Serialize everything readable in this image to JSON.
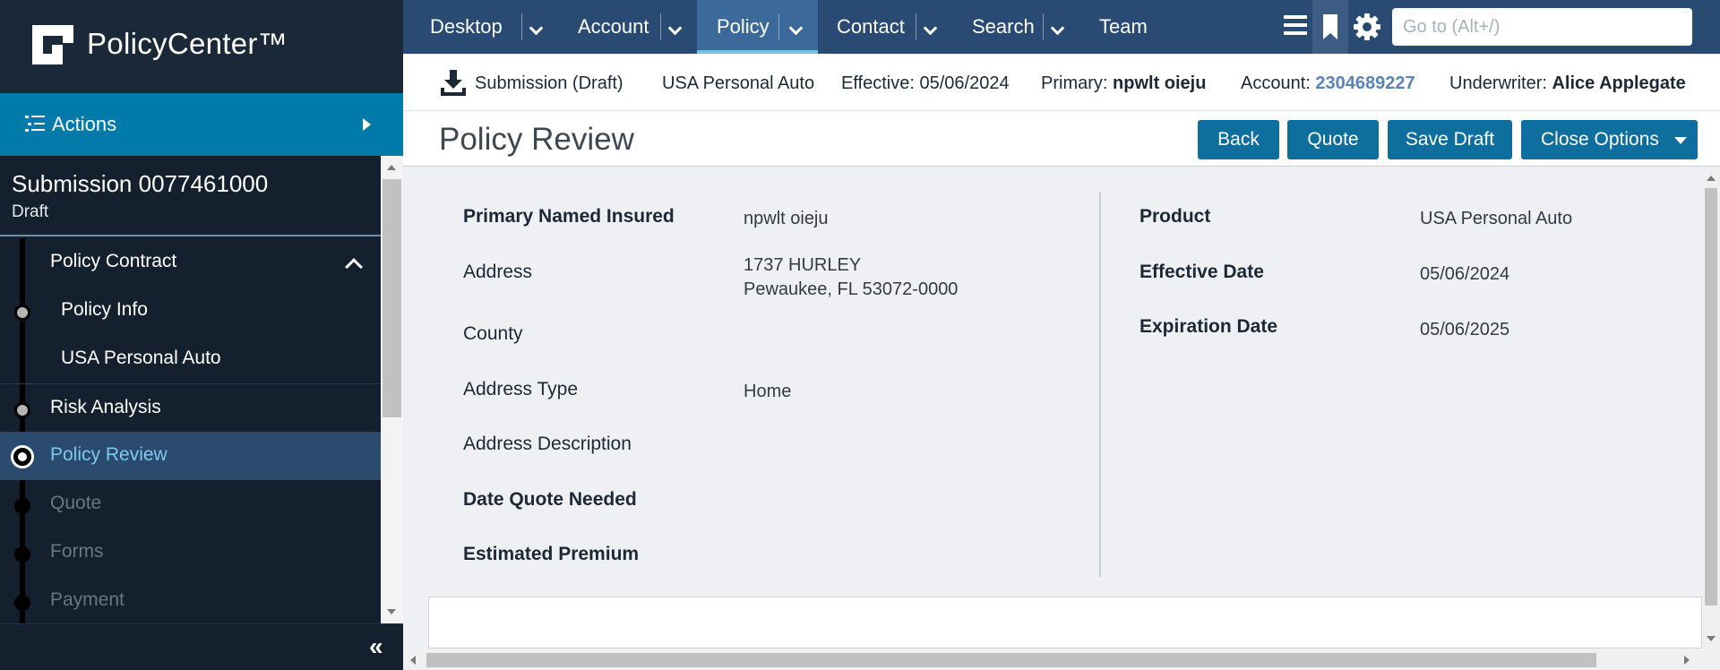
{
  "app": {
    "name": "PolicyCenter™"
  },
  "sidebar": {
    "actions_label": "Actions",
    "job": {
      "title": "Submission 0077461000",
      "status": "Draft"
    },
    "nav": [
      {
        "label": "Policy Contract",
        "state": "group"
      },
      {
        "label": "Policy Info",
        "state": "completed"
      },
      {
        "label": "USA Personal Auto",
        "state": "normal"
      },
      {
        "label": "Risk Analysis",
        "state": "completed"
      },
      {
        "label": "Policy Review",
        "state": "current"
      },
      {
        "label": "Quote",
        "state": "disabled"
      },
      {
        "label": "Forms",
        "state": "disabled"
      },
      {
        "label": "Payment",
        "state": "disabled"
      }
    ]
  },
  "topnav": {
    "tabs": [
      {
        "label": "Desktop",
        "active": false
      },
      {
        "label": "Account",
        "active": false
      },
      {
        "label": "Policy",
        "active": true
      },
      {
        "label": "Contact",
        "active": false
      },
      {
        "label": "Search",
        "active": false
      },
      {
        "label": "Team",
        "active": false
      }
    ],
    "goto_placeholder": "Go to (Alt+/)"
  },
  "infobar": {
    "job_type": "Submission (Draft)",
    "product": "USA Personal Auto",
    "effective_label": "Effective:",
    "effective_value": "05/06/2024",
    "primary_label": "Primary:",
    "primary_value": "npwlt oieju",
    "account_label": "Account:",
    "account_value": "2304689227",
    "underwriter_label": "Underwriter:",
    "underwriter_value": "Alice Applegate"
  },
  "page": {
    "title": "Policy Review",
    "buttons": {
      "back": "Back",
      "quote": "Quote",
      "save_draft": "Save Draft",
      "close_options": "Close Options"
    }
  },
  "review": {
    "left": {
      "primary_named_insured": {
        "label": "Primary Named Insured",
        "value": "npwlt oieju"
      },
      "address": {
        "label": "Address",
        "line1": "1737 HURLEY",
        "line2": "Pewaukee, FL 53072-0000"
      },
      "county": {
        "label": "County",
        "value": ""
      },
      "address_type": {
        "label": "Address Type",
        "value": "Home"
      },
      "address_description": {
        "label": "Address Description",
        "value": ""
      },
      "date_quote_needed": {
        "label": "Date Quote Needed",
        "value": ""
      },
      "estimated_premium": {
        "label": "Estimated Premium",
        "value": ""
      }
    },
    "right": {
      "product": {
        "label": "Product",
        "value": "USA Personal Auto"
      },
      "effective_date": {
        "label": "Effective Date",
        "value": "05/06/2024"
      },
      "expiration_date": {
        "label": "Expiration Date",
        "value": "05/06/2025"
      }
    }
  },
  "colors": {
    "sidebar_bg": "#14202e",
    "actions_bg": "#007aa8",
    "topnav_bg": "#284a73",
    "button_bg": "#0e6e9e",
    "link": "#5a84b8"
  }
}
